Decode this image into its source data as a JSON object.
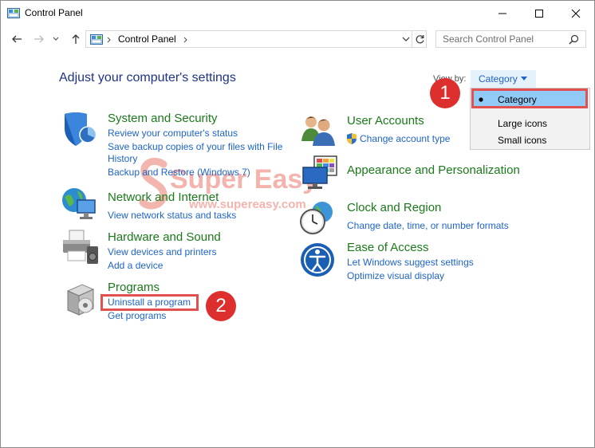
{
  "window": {
    "title": "Control Panel"
  },
  "nav": {
    "breadcrumb": "Control Panel",
    "search_placeholder": "Search Control Panel"
  },
  "main": {
    "heading": "Adjust your computer's settings",
    "view_by_label": "View by:",
    "view_by_value": "Category"
  },
  "view_menu": {
    "items": [
      "Category",
      "Large icons",
      "Small icons"
    ],
    "selected": "Category"
  },
  "categories": {
    "system": {
      "title": "System and Security",
      "links": [
        "Review your computer's status",
        "Save backup copies of your files with File",
        "History",
        "Backup and Restore (Windows 7)"
      ]
    },
    "network": {
      "title": "Network and Internet",
      "links": [
        "View network status and tasks"
      ]
    },
    "hardware": {
      "title": "Hardware and Sound",
      "links": [
        "View devices and printers",
        "Add a device"
      ]
    },
    "programs": {
      "title": "Programs",
      "links": [
        "Uninstall a program",
        "Get programs"
      ]
    },
    "users": {
      "title": "User Accounts",
      "links": [
        "Change account type"
      ]
    },
    "appearance": {
      "title": "Appearance and Personalization"
    },
    "clock": {
      "title": "Clock and Region",
      "links": [
        "Change date, time, or number formats"
      ]
    },
    "ease": {
      "title": "Ease of Access",
      "links": [
        "Let Windows suggest settings",
        "Optimize visual display"
      ]
    }
  },
  "annotations": {
    "badge1": "1",
    "badge2": "2",
    "accent_color": "#de2f2f"
  },
  "watermark": {
    "brand": "Super Easy",
    "url": "www.supereasy.com"
  }
}
